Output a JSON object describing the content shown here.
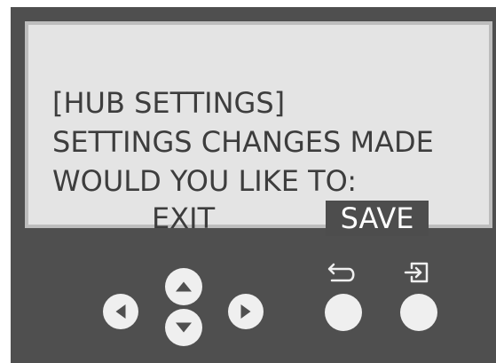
{
  "screen": {
    "title": "[HUB SETTINGS]",
    "message": "SETTINGS CHANGES MADE",
    "prompt": "WOULD YOU LIKE TO:",
    "options": {
      "exit": "EXIT",
      "save": "SAVE"
    },
    "selected_option": "SAVE"
  },
  "controls": {
    "icons": [
      "left-arrow-icon",
      "up-arrow-icon",
      "down-arrow-icon",
      "right-arrow-icon",
      "back-icon",
      "enter-icon"
    ]
  },
  "colors": {
    "panel": "#4f4f4f",
    "screen": "#e4e4e4",
    "screen_border": "#bdbdbd",
    "text": "#3d3d3d",
    "selected_background": "#4d4d4d",
    "selected_text": "#ffffff",
    "button": "#efefef"
  }
}
